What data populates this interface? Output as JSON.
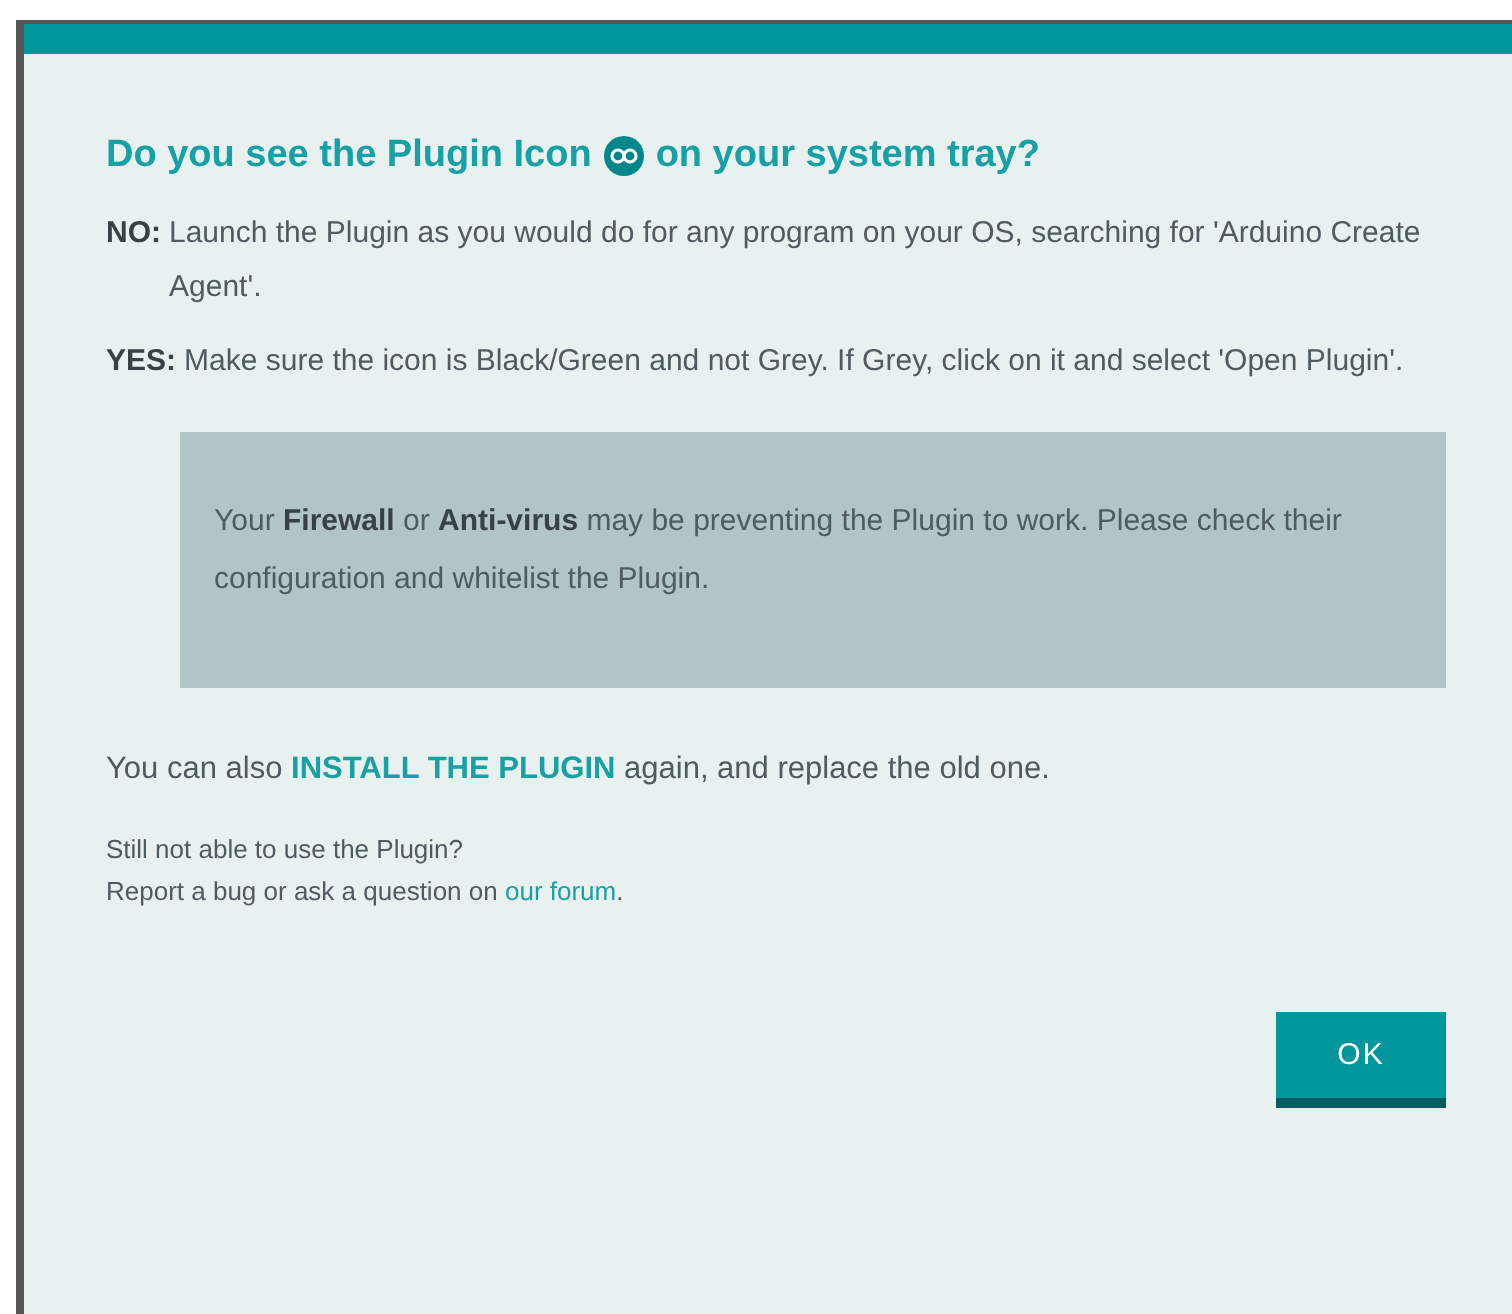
{
  "dialog": {
    "title_before": "Do you see the Plugin Icon",
    "title_after": "on your system tray?",
    "answers": [
      {
        "term": "NO:",
        "text": "Launch the Plugin as you would do for any program on your OS, searching for 'Arduino Create Agent'."
      },
      {
        "term": "YES:",
        "text": "Make sure the icon is Black/Green and not Grey. If Grey, click on it and select 'Open Plugin'."
      }
    ],
    "notice": "Your **Firewall** or **Anti-virus** may be preventing the Plugin to work. Please check their configuration and whitelist the Plugin.",
    "install": {
      "before": "You can also",
      "link": "INSTALL THE PLUGIN",
      "after": "again, and replace the old one."
    },
    "help": {
      "line1": "Still not able to use the Plugin?",
      "before": "Report a bug or ask a question on",
      "link": "our forum",
      "after": "."
    },
    "ok_button": "OK"
  }
}
